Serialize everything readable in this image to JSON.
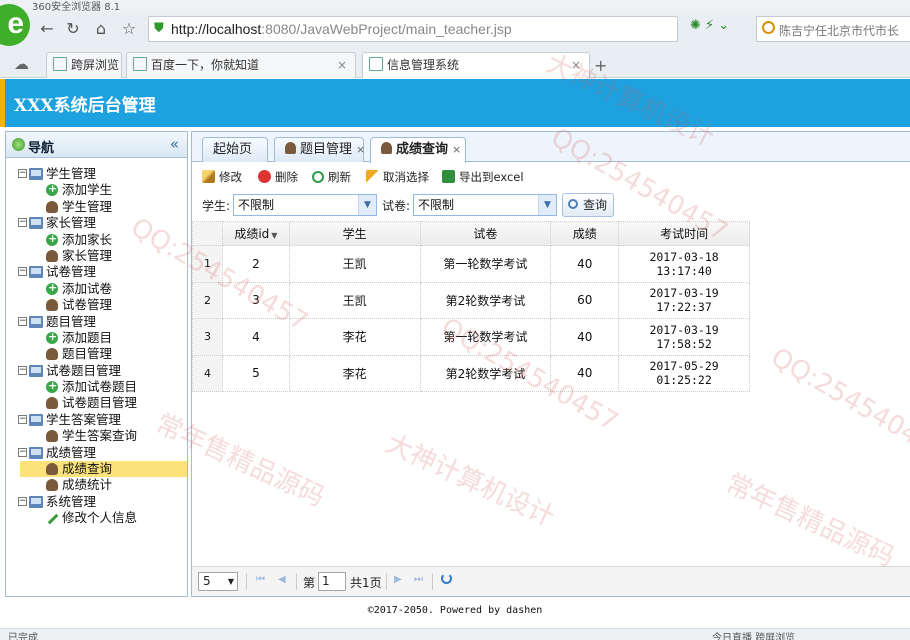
{
  "browser": {
    "name": "360安全浏览器 8.1",
    "address_host": "http://localhost",
    "address_path": ":8080/JavaWebProject/main_teacher.jsp",
    "search_text": "陈吉宁任北京市代市长",
    "tabs": [
      {
        "label": "跨屏浏览"
      },
      {
        "label": "百度一下，你就知道"
      },
      {
        "label": "信息管理系统"
      }
    ],
    "status_left": "已完成",
    "status_right": "今日直播    跨屏浏览"
  },
  "app": {
    "title": "XXX系统后台管理",
    "nav_title": "导航",
    "nav_collapse": "«"
  },
  "tree": [
    {
      "type": "group",
      "label": "学生管理"
    },
    {
      "type": "leaf",
      "icon": "add",
      "label": "添加学生"
    },
    {
      "type": "leaf",
      "icon": "user",
      "label": "学生管理"
    },
    {
      "type": "group",
      "label": "家长管理"
    },
    {
      "type": "leaf",
      "icon": "add",
      "label": "添加家长"
    },
    {
      "type": "leaf",
      "icon": "user",
      "label": "家长管理"
    },
    {
      "type": "group",
      "label": "试卷管理"
    },
    {
      "type": "leaf",
      "icon": "add",
      "label": "添加试卷"
    },
    {
      "type": "leaf",
      "icon": "user",
      "label": "试卷管理"
    },
    {
      "type": "group",
      "label": "题目管理"
    },
    {
      "type": "leaf",
      "icon": "add",
      "label": "添加题目"
    },
    {
      "type": "leaf",
      "icon": "user",
      "label": "题目管理"
    },
    {
      "type": "group",
      "label": "试卷题目管理"
    },
    {
      "type": "leaf",
      "icon": "add",
      "label": "添加试卷题目"
    },
    {
      "type": "leaf",
      "icon": "user",
      "label": "试卷题目管理"
    },
    {
      "type": "group",
      "label": "学生答案管理"
    },
    {
      "type": "leaf",
      "icon": "user",
      "label": "学生答案查询"
    },
    {
      "type": "group",
      "label": "成绩管理"
    },
    {
      "type": "leaf",
      "icon": "user",
      "label": "成绩查询",
      "selected": true
    },
    {
      "type": "leaf",
      "icon": "user",
      "label": "成绩统计"
    },
    {
      "type": "group",
      "label": "系统管理"
    },
    {
      "type": "leaf",
      "icon": "edit",
      "label": "修改个人信息"
    }
  ],
  "main_tabs": [
    {
      "label": "起始页",
      "closable": false,
      "icon": false
    },
    {
      "label": "题目管理",
      "closable": true,
      "icon": true
    },
    {
      "label": "成绩查询",
      "closable": true,
      "icon": true,
      "active": true
    }
  ],
  "toolbar": {
    "edit": "修改",
    "delete": "删除",
    "refresh": "刷新",
    "cancel_select": "取消选择",
    "export": "导出到excel"
  },
  "filters": {
    "student_label": "学生:",
    "student_value": "不限制",
    "paper_label": "试卷:",
    "paper_value": "不限制",
    "query_label": "查询"
  },
  "grid": {
    "columns": [
      "成绩id",
      "学生",
      "试卷",
      "成绩",
      "考试时间"
    ],
    "rows": [
      {
        "n": "1",
        "id": "2",
        "student": "王凯",
        "paper": "第一轮数学考试",
        "score": "40",
        "time": "2017-03-18 13:17:40"
      },
      {
        "n": "2",
        "id": "3",
        "student": "王凯",
        "paper": "第2轮数学考试",
        "score": "60",
        "time": "2017-03-19 17:22:37"
      },
      {
        "n": "3",
        "id": "4",
        "student": "李花",
        "paper": "第一轮数学考试",
        "score": "40",
        "time": "2017-03-19 17:58:52"
      },
      {
        "n": "4",
        "id": "5",
        "student": "李花",
        "paper": "第2轮数学考试",
        "score": "40",
        "time": "2017-05-29 01:25:22"
      }
    ]
  },
  "pager": {
    "page_size": "5",
    "page_prefix": "第",
    "page_value": "1",
    "page_suffix": "共1页"
  },
  "footer": "©2017-2050. Powered by dashen",
  "watermarks": [
    "QQ:254540457",
    "大神计算机设计",
    "常年售精品源码"
  ]
}
